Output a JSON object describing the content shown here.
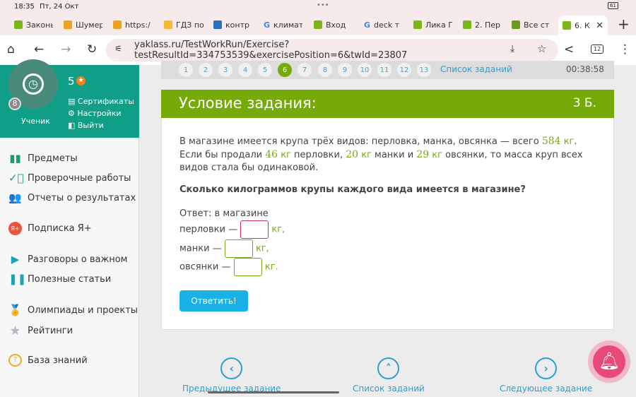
{
  "status_bar": {
    "time": "18:35",
    "date": "Пт, 24 Окт",
    "battery": "61"
  },
  "tabs": [
    {
      "label": "Законы"
    },
    {
      "label": "Шумер"
    },
    {
      "label": "https:/"
    },
    {
      "label": "ГДЗ по"
    },
    {
      "label": "контр"
    },
    {
      "label": "климат"
    },
    {
      "label": "Вход"
    },
    {
      "label": "deck т"
    },
    {
      "label": "Лика Г"
    },
    {
      "label": "2. Пер"
    },
    {
      "label": "Все ст"
    },
    {
      "label": "6. К"
    }
  ],
  "address_bar": {
    "url": "yaklass.ru/TestWorkRun/Exercise?testResultId=334753539&exercisePosition=6&twId=23807",
    "tab_count": "12"
  },
  "profile": {
    "level": "5",
    "role": "Ученик",
    "badge": "8",
    "links": [
      "Сертификаты",
      "Настройки",
      "Выйти"
    ]
  },
  "sidebar": {
    "items": [
      {
        "label": "Предметы",
        "icon": "books-icon",
        "color": "#1a9e6e"
      },
      {
        "label": "Проверочные работы",
        "icon": "check-circle-icon",
        "color": "#1a9e6e"
      },
      {
        "label": "Отчеты о результатах",
        "icon": "users-icon",
        "color": "#1a9e6e"
      },
      {
        "label": "Подписка Я+",
        "icon": "ya-plus-icon",
        "color": "#e8553a"
      },
      {
        "label": "Разговоры о важном",
        "icon": "play-icon",
        "color": "#1aa3b5"
      },
      {
        "label": "Полезные статьи",
        "icon": "articles-icon",
        "color": "#1aa3b5"
      },
      {
        "label": "Олимпиады и проекты",
        "icon": "medal-icon",
        "color": "#1aa3b5"
      },
      {
        "label": "Рейтинги",
        "icon": "star-icon",
        "color": "#b0b8c0"
      },
      {
        "label": "База знаний",
        "icon": "question-icon",
        "color": "#e8b020"
      }
    ]
  },
  "pager": {
    "pages": [
      "1",
      "2",
      "3",
      "4",
      "5",
      "6",
      "7",
      "8",
      "9",
      "10",
      "11",
      "12",
      "13"
    ],
    "current": "6",
    "list_link": "Список заданий",
    "timer": "00:38:58"
  },
  "task": {
    "title": "Условие задания:",
    "points": "3 Б.",
    "l1a": "В магазине имеется крупа трёх видов: перловка, манка, овсянка — всего ",
    "total": "584",
    "kg": "кг",
    "l1b": ".",
    "l2a": "Если бы продали ",
    "v1": "46",
    "l2b": " перловки, ",
    "v2": "20",
    "l2c": " манки и ",
    "v3": "29",
    "l2d": " овсянки, то масса круп всех видов стала бы одинаковой.",
    "question": "Сколько килограммов крупы каждого вида имеется в магазине?",
    "answer_intro": "Ответ: в магазине",
    "rows": [
      {
        "label": "перловки —",
        "unit": "кг,"
      },
      {
        "label": "манки —",
        "unit": "кг,"
      },
      {
        "label": "овсянки —",
        "unit": "кг."
      }
    ],
    "submit": "Ответить!"
  },
  "bottom_nav": {
    "prev": "Предыдущее задание",
    "list": "Список заданий",
    "next": "Следующее задание"
  }
}
